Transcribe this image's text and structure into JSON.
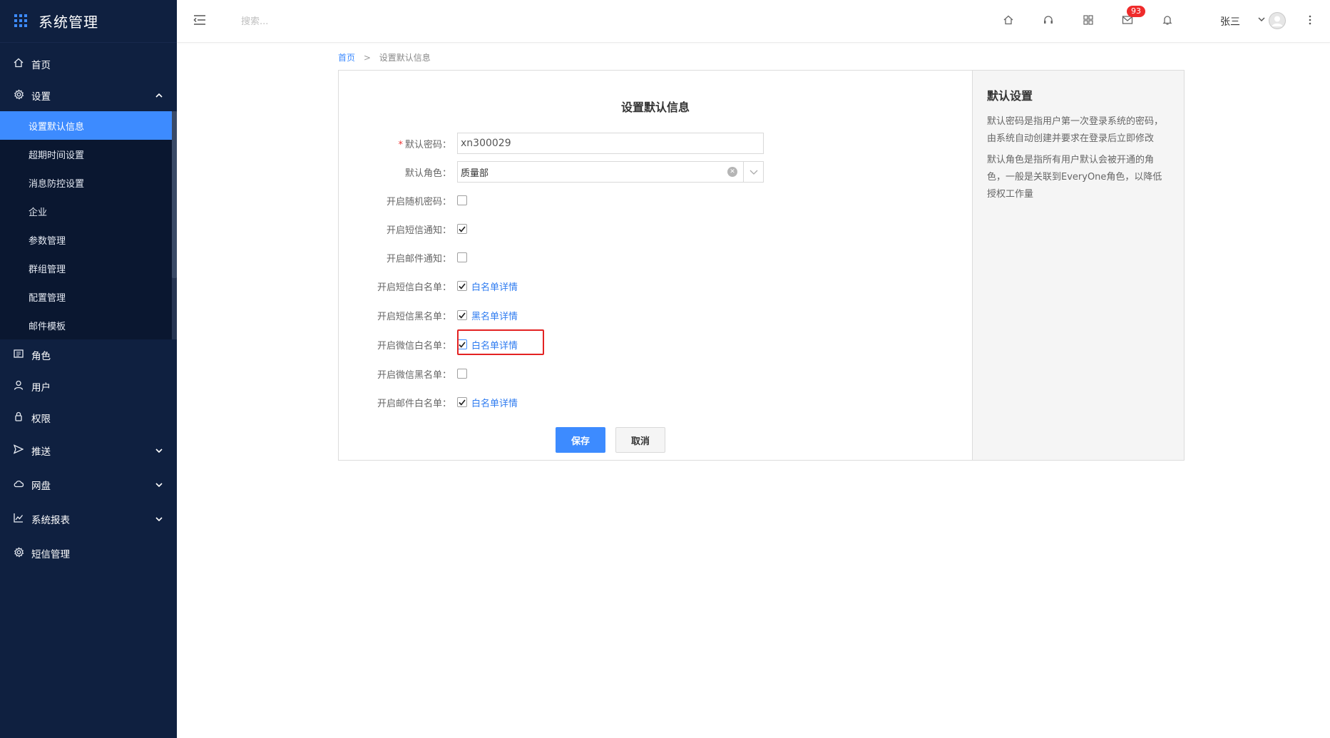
{
  "app": {
    "title": "系统管理"
  },
  "sidebar": {
    "items": [
      {
        "label": "首页",
        "icon": "home-icon"
      },
      {
        "label": "设置",
        "icon": "gear-icon",
        "expanded": true
      }
    ],
    "settings_sub": [
      {
        "label": "设置默认信息",
        "active": true
      },
      {
        "label": "超期时间设置"
      },
      {
        "label": "消息防控设置"
      },
      {
        "label": "企业"
      },
      {
        "label": "参数管理"
      },
      {
        "label": "群组管理"
      },
      {
        "label": "配置管理"
      },
      {
        "label": "邮件模板"
      }
    ],
    "items_after": [
      {
        "label": "角色",
        "icon": "role-icon"
      },
      {
        "label": "用户",
        "icon": "user-icon"
      },
      {
        "label": "权限",
        "icon": "lock-icon"
      },
      {
        "label": "推送",
        "icon": "send-icon",
        "has_children": true
      },
      {
        "label": "网盘",
        "icon": "cloud-icon",
        "has_children": true
      },
      {
        "label": "系统报表",
        "icon": "chart-icon",
        "has_children": true
      },
      {
        "label": "短信管理",
        "icon": "gear-icon"
      }
    ]
  },
  "header": {
    "search_placeholder": "搜索...",
    "mail_badge": "93",
    "user_name": "张三"
  },
  "breadcrumb": {
    "home": "首页",
    "separator": ">",
    "current": "设置默认信息"
  },
  "form": {
    "title": "设置默认信息",
    "password": {
      "label": "默认密码：",
      "value": "xn300029",
      "required": true
    },
    "role": {
      "label": "默认角色：",
      "value": "质量部"
    },
    "random_password": {
      "label": "开启随机密码：",
      "checked": false
    },
    "sms_notify": {
      "label": "开启短信通知：",
      "checked": true
    },
    "email_notify": {
      "label": "开启邮件通知：",
      "checked": false
    },
    "sms_whitelist": {
      "label": "开启短信白名单：",
      "checked": true,
      "link": "白名单详情"
    },
    "sms_blacklist": {
      "label": "开启短信黑名单：",
      "checked": true,
      "link": "黑名单详情"
    },
    "wechat_whitelist": {
      "label": "开启微信白名单：",
      "checked": true,
      "link": "白名单详情"
    },
    "wechat_blacklist": {
      "label": "开启微信黑名单：",
      "checked": false
    },
    "email_whitelist": {
      "label": "开启邮件白名单：",
      "checked": true,
      "link": "白名单详情"
    },
    "save_label": "保存",
    "cancel_label": "取消"
  },
  "help": {
    "title": "默认设置",
    "paragraphs": [
      "默认密码是指用户第一次登录系统的密码，由系统自动创建并要求在登录后立即修改",
      "默认角色是指所有用户默认会被开通的角色，一般是关联到EveryOne角色，以降低授权工作量"
    ]
  },
  "colors": {
    "sidebar_bg": "#0f2040",
    "accent": "#3d8bff",
    "highlight": "#e32222",
    "badge": "#ef2b2b"
  }
}
